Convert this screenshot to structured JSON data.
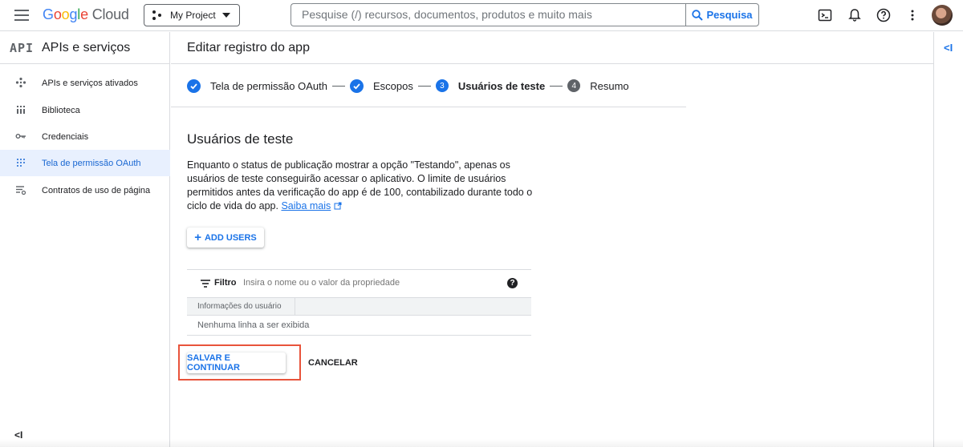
{
  "topbar": {
    "logo_google": [
      "G",
      "o",
      "o",
      "g",
      "l",
      "e"
    ],
    "logo_cloud": "Cloud",
    "project_label": "My Project",
    "search_placeholder": "Pesquise (/) recursos, documentos, produtos e muito mais",
    "search_button": "Pesquisa"
  },
  "sidebar": {
    "badge": "API",
    "title": "APIs e serviços",
    "items": [
      {
        "label": "APIs e serviços ativados",
        "icon": "apis-dashboard-icon"
      },
      {
        "label": "Biblioteca",
        "icon": "library-icon"
      },
      {
        "label": "Credenciais",
        "icon": "key-icon"
      },
      {
        "label": "Tela de permissão OAuth",
        "icon": "oauth-consent-icon",
        "active": true
      },
      {
        "label": "Contratos de uso de página",
        "icon": "page-usage-icon"
      }
    ],
    "collapse": "<I"
  },
  "main": {
    "title": "Editar registro do app",
    "steps": [
      {
        "label": "Tela de permissão OAuth",
        "state": "done"
      },
      {
        "label": "Escopos",
        "state": "done"
      },
      {
        "label": "Usuários de teste",
        "state": "current",
        "number": "3"
      },
      {
        "label": "Resumo",
        "state": "pending",
        "number": "4"
      }
    ],
    "section_title": "Usuários de teste",
    "description": "Enquanto o status de publicação mostrar a opção \"Testando\", apenas os usuários de teste conseguirão acessar o aplicativo. O limite de usuários permitidos antes da verificação do app é de 100, contabilizado durante todo o ciclo de vida do app.",
    "learn_more": "Saiba mais",
    "add_users": "ADD USERS",
    "filter": {
      "label": "Filtro",
      "placeholder": "Insira o nome ou o valor da propriedade"
    },
    "table": {
      "column": "Informações do usuário",
      "empty": "Nenhuma linha a ser exibida"
    },
    "save_button": "SALVAR E CONTINUAR",
    "cancel_button": "CANCELAR"
  },
  "right_rail": {
    "toggle": "<I"
  },
  "colors": {
    "accent": "#1a73e8",
    "highlight": "#e8543b",
    "active_bg": "#e8f0fe"
  }
}
